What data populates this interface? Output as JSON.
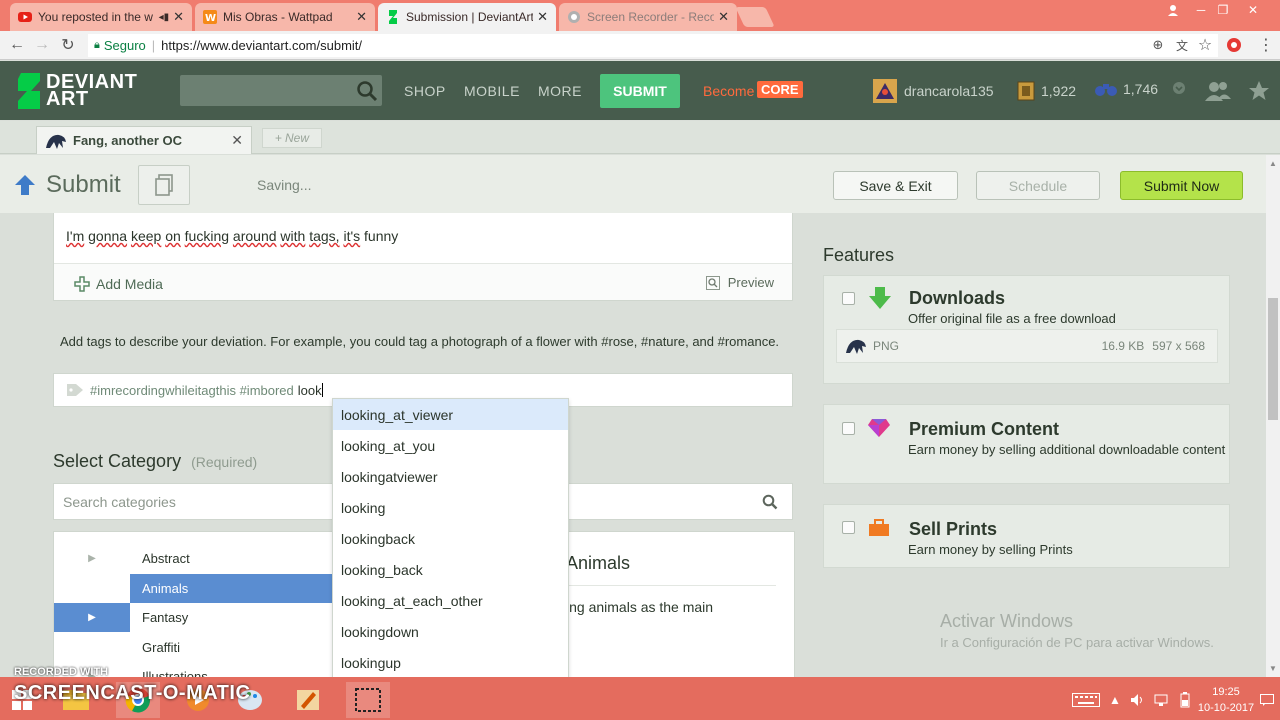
{
  "browser": {
    "tabs": [
      {
        "title": "You reposted in the w",
        "icon": "youtube-icon"
      },
      {
        "title": "Mis Obras - Wattpad",
        "icon": "wattpad-icon"
      },
      {
        "title": "Submission | DeviantArt",
        "icon": "deviantart-icon"
      },
      {
        "title": "Screen Recorder - Recor",
        "icon": "screencast-icon"
      }
    ],
    "secure_label": "Seguro",
    "url": "https://www.deviantart.com/submit/"
  },
  "da_header": {
    "logo_line1": "DEVIANT",
    "logo_line2": "ART",
    "nav": [
      "SHOP",
      "MOBILE",
      "MORE"
    ],
    "submit": "SUBMIT",
    "become": "Become",
    "core": "CORE",
    "username": "drancarola135",
    "points": "1,922",
    "watchers": "1,746"
  },
  "doc_tabs": {
    "active": "Fang, another OC",
    "new": "New"
  },
  "toolbar": {
    "title": "Submit",
    "status": "Saving...",
    "save_exit": "Save & Exit",
    "schedule": "Schedule",
    "submit_now": "Submit Now"
  },
  "description": {
    "words": [
      "I'm",
      "gonna",
      "keep",
      "on",
      "fucking",
      "around",
      "with",
      "tags,",
      "it's",
      "funny"
    ],
    "add_media": "Add Media",
    "preview": "Preview"
  },
  "tags": {
    "help": "Add tags to describe your deviation. For example, you could tag a photograph of a flower with #rose, #nature, and #romance.",
    "existing": "#imrecordingwhileitagthis #imbored",
    "typed": "look"
  },
  "suggestions": [
    "looking_at_viewer",
    "looking_at_you",
    "lookingatviewer",
    "looking",
    "lookingback",
    "looking_back",
    "looking_at_each_other",
    "lookingdown",
    "lookingup"
  ],
  "category": {
    "title": "Select Category",
    "required": "(Required)",
    "search_placeholder": "Search categories",
    "items": [
      "Abstract",
      "Animals",
      "Fantasy",
      "Graffiti",
      "Illustrations"
    ],
    "detail_title": "Animals",
    "detail_desc": "ing animals as the main"
  },
  "features": {
    "title": "Features",
    "downloads": {
      "name": "Downloads",
      "desc": "Offer original file as a free download",
      "file_type": "PNG",
      "file_size": "16.9 KB",
      "dimensions": "597 x 568"
    },
    "premium": {
      "name": "Premium Content",
      "desc": "Earn money by selling additional downloadable content"
    },
    "prints": {
      "name": "Sell Prints",
      "desc": "Earn money by selling Prints"
    }
  },
  "windows": {
    "activate_title": "Activar Windows",
    "activate_desc": "Ir a Configuración de PC para activar Windows.",
    "time": "19:25",
    "date": "10-10-2017"
  },
  "watermark": {
    "line1": "RECORDED WITH",
    "line2": "SCREENCAST-O-MATIC"
  },
  "colors": {
    "da_header": "#475c4d",
    "submit_green": "#4dc47d",
    "submit_now": "#b4e34a",
    "core_orange": "#ff6a3d",
    "selected_blue": "#5a8dd1"
  }
}
